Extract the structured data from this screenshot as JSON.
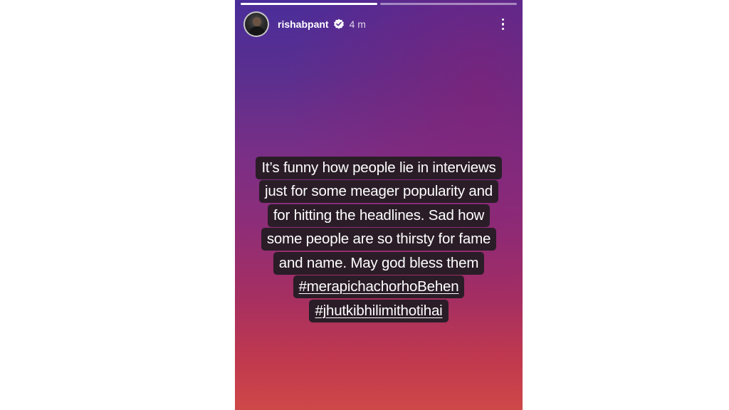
{
  "story": {
    "progress": {
      "total_segments": 2,
      "active_segment": 1
    },
    "header": {
      "username": "rishabpant",
      "verified": true,
      "time": "4 m"
    },
    "icons": {
      "verified": "verified-badge-icon",
      "menu": "more-vertical-icon",
      "avatar": "profile-avatar"
    },
    "text_lines": [
      "It’s funny how people lie in interviews",
      "just for some meager popularity and",
      "for hitting the headlines. Sad how",
      "some people are so thirsty for fame",
      "and name. May god bless them"
    ],
    "hashtags": [
      "#merapichachorhoBehen",
      "#jhutkibhilimithotihai"
    ]
  },
  "colors": {
    "gradient_top": "#4a2d9a",
    "gradient_middle": "#8e2d78",
    "gradient_bottom": "#cf4848",
    "text_highlight": "#2a1d27",
    "text": "#ffffff"
  }
}
